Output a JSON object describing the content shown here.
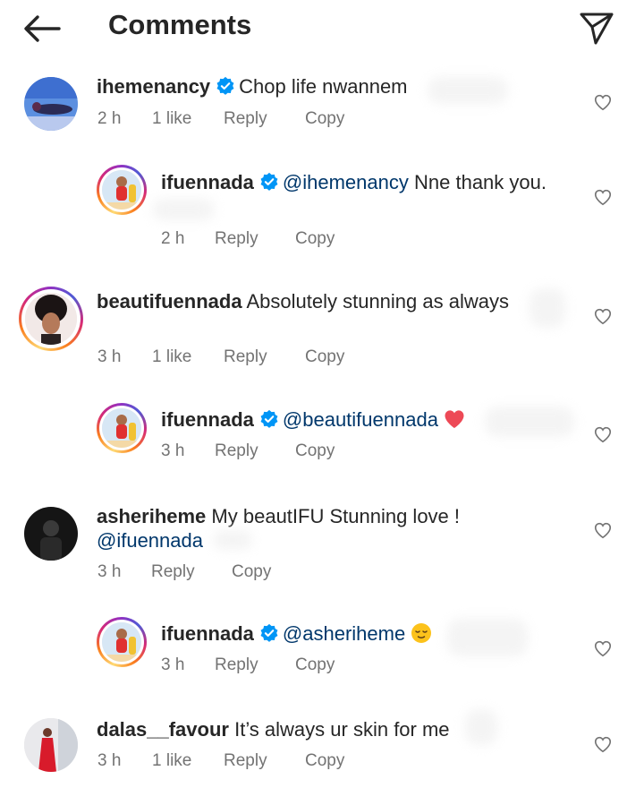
{
  "header": {
    "title": "Comments",
    "back_icon": "arrow-left-icon",
    "share_icon": "paper-plane-icon"
  },
  "colors": {
    "text": "#262626",
    "meta": "#737373",
    "mention": "#00376b",
    "verified": "#0095f6",
    "heart_red": "#ed4956"
  },
  "comments": [
    {
      "username": "ihemenancy",
      "verified": true,
      "text": "Chop life nwannem",
      "time": "2 h",
      "likes": "1 like",
      "reply": "Reply",
      "copy": "Copy"
    },
    {
      "username": "ifuennada",
      "verified": true,
      "mention": "@ihemenancy",
      "text": "Nne thank you.",
      "time": "2 h",
      "reply": "Reply",
      "copy": "Copy"
    },
    {
      "username": "beautifuennada",
      "text": "Absolutely stunning as always",
      "time": "3 h",
      "likes": "1 like",
      "reply": "Reply",
      "copy": "Copy"
    },
    {
      "username": "ifuennada",
      "verified": true,
      "mention": "@beautifuennada",
      "emoji": "red-heart-emoji",
      "time": "3 h",
      "reply": "Reply",
      "copy": "Copy"
    },
    {
      "username": "asheriheme",
      "text": "My beautIFU Stunning love !",
      "mention": "@ifuennada",
      "time": "3 h",
      "reply": "Reply",
      "copy": "Copy"
    },
    {
      "username": "ifuennada",
      "verified": true,
      "mention": "@asheriheme",
      "emoji": "relieved-face-emoji",
      "time": "3 h",
      "reply": "Reply",
      "copy": "Copy"
    },
    {
      "username": "dalas__favour",
      "text": "It’s always ur skin for me",
      "time": "3 h",
      "likes": "1 like",
      "reply": "Reply",
      "copy": "Copy"
    }
  ]
}
